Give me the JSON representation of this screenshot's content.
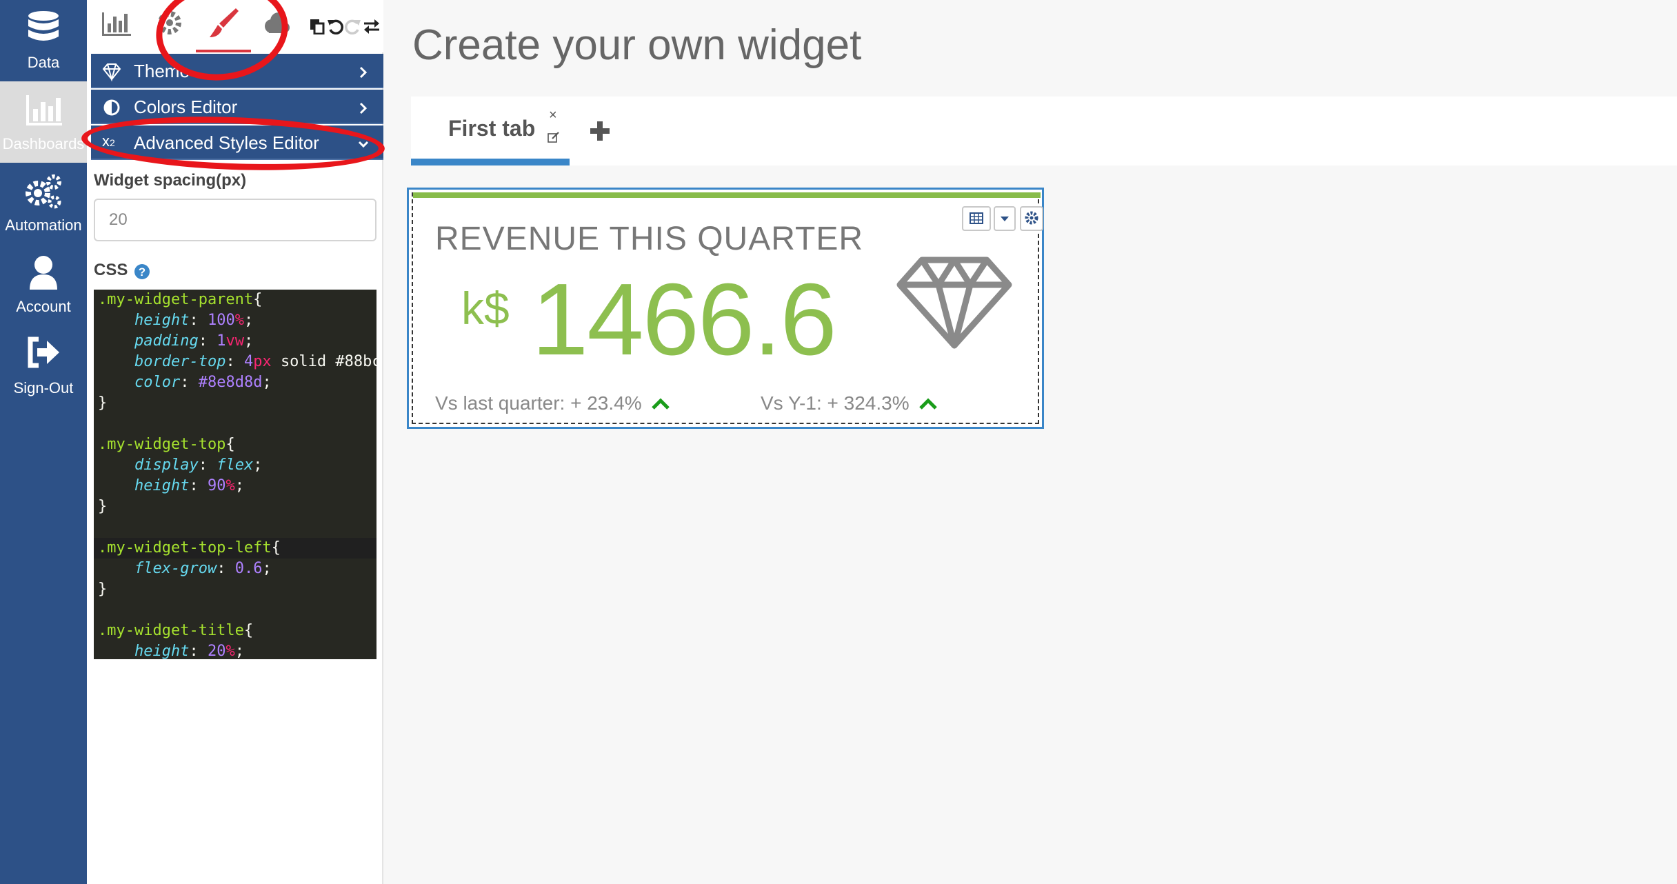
{
  "nav": {
    "items": [
      {
        "label": "Data",
        "icon": "database-icon"
      },
      {
        "label": "Dashboards",
        "icon": "bar-chart-icon"
      },
      {
        "label": "Automation",
        "icon": "gears-icon"
      },
      {
        "label": "Account",
        "icon": "user-icon"
      },
      {
        "label": "Sign-Out",
        "icon": "sign-out-icon"
      }
    ]
  },
  "panel": {
    "toolbar": [
      "chart-tab-icon",
      "settings-tab-icon",
      "brush-tab-icon",
      "cloud-tab-icon",
      "copy-icon",
      "undo-icon",
      "redo-icon",
      "swap-icon"
    ],
    "menu": {
      "theme": "Theme",
      "colors_editor": "Colors Editor",
      "advanced_styles_editor": "Advanced Styles Editor",
      "advanced_prefix": "x"
    },
    "widget_spacing_label": "Widget spacing(px)",
    "widget_spacing_value": "20",
    "css_label": "CSS"
  },
  "main": {
    "page_title": "Create your own widget",
    "tabs": [
      {
        "label": "First tab"
      }
    ],
    "tab_close": "×"
  },
  "widget": {
    "title": "REVENUE THIS QUARTER",
    "prefix": "k$",
    "value": "1466.6",
    "vs_last_quarter": "Vs last quarter: + 23.4%",
    "vs_year": "Vs Y-1: + 324.3%",
    "accent_color": "#8dbf4f",
    "up_arrow_color": "#1a9c1a"
  },
  "colors": {
    "nav_bg": "#2d5187",
    "annotation": "#e8161b",
    "tab_active": "#3a86c8"
  }
}
